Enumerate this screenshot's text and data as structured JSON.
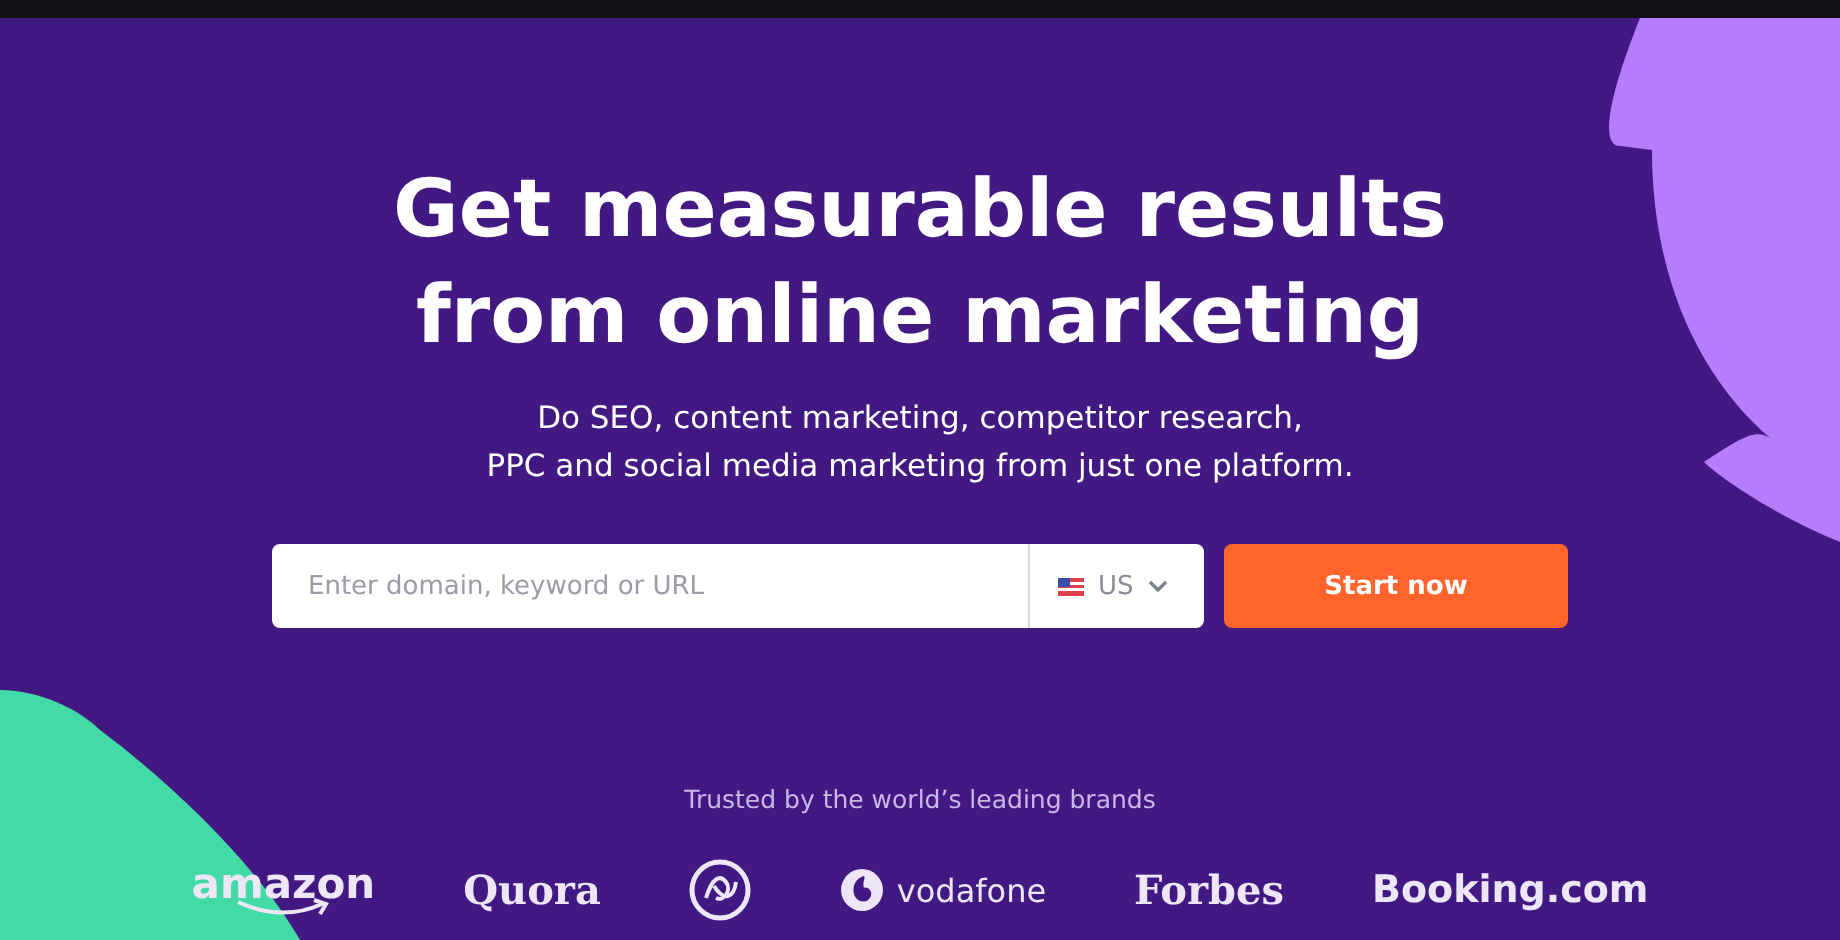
{
  "hero": {
    "headline": [
      "Get measurable results",
      "from online marketing"
    ],
    "subtitle": [
      "Do SEO, content marketing, competitor research,",
      "PPC and social media marketing from just one platform."
    ]
  },
  "search": {
    "placeholder": "Enter domain, keyword or URL",
    "country": "US",
    "button": "Start now"
  },
  "brands": {
    "caption": "Trusted by the world’s leading brands",
    "items": [
      {
        "kind": "smile",
        "label": "amazon"
      },
      {
        "kind": "serif",
        "label": "Quora"
      },
      {
        "kind": "monogram"
      },
      {
        "kind": "speech",
        "label": "vodafone"
      },
      {
        "kind": "serif",
        "label": "Forbes"
      },
      {
        "kind": "sans",
        "label": "Booking.com"
      }
    ]
  }
}
